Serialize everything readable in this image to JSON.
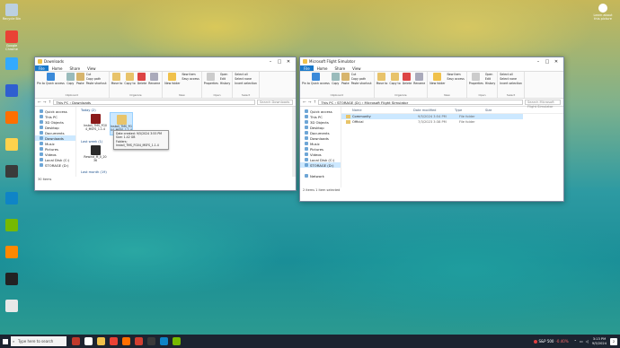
{
  "desktop": {
    "icons": [
      {
        "label": "Recycle Bin",
        "color": "#bcd0e0"
      },
      {
        "label": "Google Chrome",
        "color": "#e94235"
      },
      {
        "label": "",
        "color": "#33aaff"
      },
      {
        "label": "",
        "color": "#2f5fd0"
      },
      {
        "label": "",
        "color": "#ff6f00"
      },
      {
        "label": "",
        "color": "#ffd24d"
      },
      {
        "label": "",
        "color": "#3a3a3a"
      },
      {
        "label": "",
        "color": "#0f84c6"
      },
      {
        "label": "",
        "color": "#76b900"
      },
      {
        "label": "",
        "color": "#ff8800"
      },
      {
        "label": "",
        "color": "#222222"
      },
      {
        "label": "",
        "color": "#e8e8e8"
      }
    ],
    "right_icon": {
      "label": "Learn about this picture"
    }
  },
  "win1": {
    "title": "Downloads",
    "tabs": [
      "File",
      "Home",
      "Share",
      "View"
    ],
    "ribbon": {
      "clipboard": {
        "pin": "Pin to Quick access",
        "copy": "Copy",
        "paste": "Paste",
        "cut": "Cut",
        "copy_path": "Copy path",
        "paste_shortcut": "Paste shortcut",
        "group": "Clipboard"
      },
      "organize": {
        "move_to": "Move to",
        "copy_to": "Copy to",
        "delete": "Delete",
        "rename": "Rename",
        "group": "Organize"
      },
      "new": {
        "new_folder": "New folder",
        "new_item": "New item",
        "easy_access": "Easy access",
        "group": "New"
      },
      "open": {
        "properties": "Properties",
        "open": "Open",
        "edit": "Edit",
        "history": "History",
        "group": "Open"
      },
      "select": {
        "select_all": "Select all",
        "select_none": "Select none",
        "invert": "Invert selection",
        "group": "Select"
      }
    },
    "path": "This PC  ›  Downloads",
    "search": "Search Downloads",
    "nav": [
      "Quick access",
      "This PC",
      "3D Objects",
      "Desktop",
      "Documents",
      "Downloads",
      "Music",
      "Pictures",
      "Videos",
      "Local Disk (C:)",
      "STORAGE (D:)"
    ],
    "groups": {
      "today": "Today (2)",
      "last_week": "Last week (1)",
      "last_month": "Last month (19)"
    },
    "files": [
      {
        "name": "Install_TMS_FG04_MSFS_1.1.4",
        "color": "#8b1a1a"
      },
      {
        "name": "Install_TMS_FG04_MSFS_1.1.4",
        "color": "#e8c46a"
      },
      {
        "name": "Rewind_M_0_2036",
        "color": "#2a2a2a"
      }
    ],
    "tooltip": {
      "created": "Date created: 9/5/2024 3:55 PM",
      "size": "Size: 1.42 GB",
      "folders": "Folders: Install_TMS_FG04_MSFS_1.1.4"
    },
    "status": "30 items"
  },
  "win2": {
    "title": "Microsoft Flight Simulator",
    "tabs": [
      "File",
      "Home",
      "Share",
      "View"
    ],
    "path": "This PC  ›  STORAGE (D:)  ›  Microsoft Flight Simulator",
    "search": "Search Microsoft Flight Simulator",
    "nav": [
      "Quick access",
      "This PC",
      "3D Objects",
      "Desktop",
      "Documents",
      "Downloads",
      "Music",
      "Pictures",
      "Videos",
      "Local Disk (C:)",
      "STORAGE (D:)",
      "",
      "Network"
    ],
    "columns": [
      "Name",
      "Date modified",
      "Type",
      "Size"
    ],
    "rows": [
      {
        "name": "Community",
        "date": "9/5/2024 3:54 PM",
        "type": "File folder"
      },
      {
        "name": "Official",
        "date": "7/3/2023 3:38 PM",
        "type": "File folder"
      }
    ],
    "status": "2 items    1 item selected"
  },
  "taskbar": {
    "search_placeholder": "Type here to search",
    "stock_name": "S&P 500",
    "stock_change": "-0.40%",
    "time": "3:13 PM",
    "date": "9/5/2024",
    "notif_count": "2"
  }
}
